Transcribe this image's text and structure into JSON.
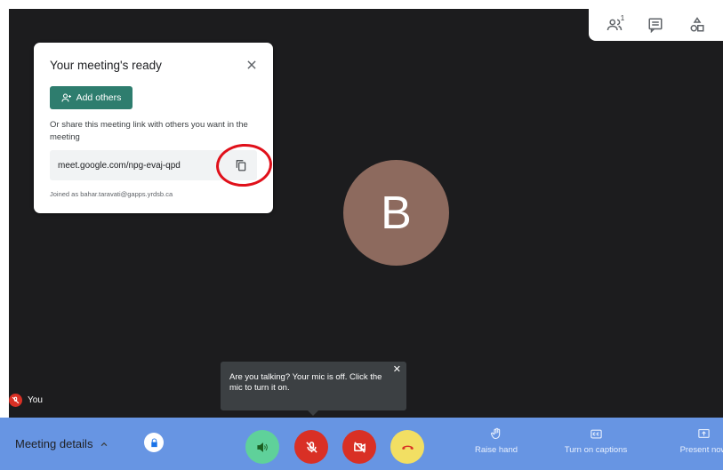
{
  "top_bar": {
    "participant_count": "1"
  },
  "ready_card": {
    "title": "Your meeting's ready",
    "add_others_label": "Add others",
    "share_text": "Or share this meeting link with others you want in the meeting",
    "meeting_link": "meet.google.com/npg-evaj-qpd",
    "joined_as": "Joined as bahar.taravati@gapps.yrdsb.ca"
  },
  "avatar": {
    "initial": "B",
    "color": "#8d6a5e"
  },
  "self_view": {
    "name": "You"
  },
  "mic_tooltip": {
    "text": "Are you talking? Your mic is off. Click the mic to turn it on.",
    "close_symbol": "✕"
  },
  "bottom_bar": {
    "meeting_details_label": "Meeting details",
    "raise_hand_label": "Raise hand",
    "captions_label": "Turn on captions",
    "present_label": "Present now"
  },
  "colors": {
    "bottom_bar": "#6795e3",
    "stage": "#1c1c1e",
    "accent_green": "#2e7d6e",
    "danger_red": "#d93025",
    "hangup_yellow": "#f2df63",
    "speaker_green": "#5fd19a",
    "annotation_red": "#e0101a"
  }
}
